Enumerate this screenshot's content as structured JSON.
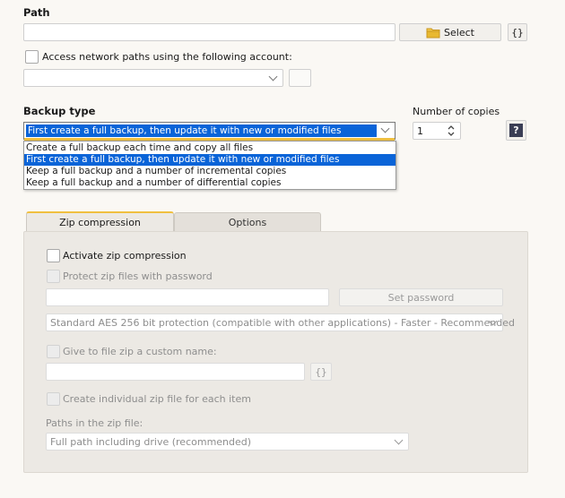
{
  "path": {
    "label": "Path",
    "value": "",
    "select_label": "Select",
    "vars_label": "{}"
  },
  "network": {
    "checkbox_label": "Access network paths using the following account:",
    "account_value": ""
  },
  "backup_type": {
    "label": "Backup type",
    "selected": "First create a full backup, then update it with new or modified files",
    "options": [
      "Create a full backup each time and copy all files",
      "First create a full backup, then update it with new or modified files",
      "Keep a full backup and a number of incremental copies",
      "Keep a full backup and a number of differential copies"
    ],
    "selected_index": 1
  },
  "copies": {
    "label": "Number of copies",
    "value": "1",
    "help_label": "?"
  },
  "tabs": [
    {
      "label": "Zip compression",
      "active": true
    },
    {
      "label": "Options",
      "active": false
    }
  ],
  "zip": {
    "activate_label": "Activate zip compression",
    "protect_label": "Protect zip files with password",
    "password_value": "",
    "set_password_label": "Set password",
    "encryption_value": "Standard AES 256 bit protection (compatible with other applications) - Faster - Recommended",
    "custom_name_label": "Give to file zip a custom name:",
    "custom_name_value": "",
    "vars_label": "{}",
    "individual_label": "Create individual zip file for each item",
    "paths_label": "Paths in the zip file:",
    "paths_value": "Full path including drive (recommended)"
  },
  "colors": {
    "selection": "#0a64d8",
    "folder_icon": "#e8b830"
  }
}
